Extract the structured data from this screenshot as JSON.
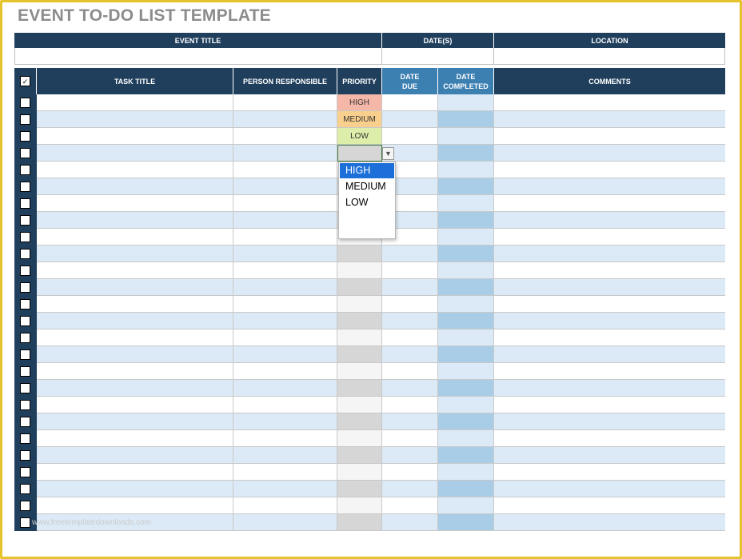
{
  "title": "EVENT TO-DO LIST TEMPLATE",
  "event_header": {
    "columns": [
      "EVENT TITLE",
      "DATE(S)",
      "LOCATION"
    ]
  },
  "task_table": {
    "header_checkbox": "✓",
    "columns": {
      "task_title": "TASK TITLE",
      "person_responsible": "PERSON RESPONSIBLE",
      "priority": "PRIORITY",
      "date_due": "DATE DUE",
      "date_completed": "DATE COMPLETED",
      "comments": "COMMENTS"
    },
    "row_count": 26,
    "priority_values": [
      "HIGH",
      "MEDIUM",
      "LOW",
      "",
      "",
      "",
      "",
      "",
      "",
      "",
      "",
      "",
      "",
      "",
      "",
      "",
      "",
      "",
      "",
      "",
      "",
      "",
      "",
      "",
      "",
      ""
    ]
  },
  "dropdown": {
    "arrow": "▼",
    "options": [
      "HIGH",
      "MEDIUM",
      "LOW"
    ],
    "selected": "HIGH"
  },
  "colors": {
    "header_navy": "#203f5c",
    "header_date_blue": "#3c7fb1",
    "row_band": "#dbeaf6",
    "high": "#f5b7a8",
    "medium": "#f9cf8e",
    "low": "#dceea9",
    "frame": "#e5c32d"
  },
  "watermark": "www.freetemplatedownloads.com"
}
